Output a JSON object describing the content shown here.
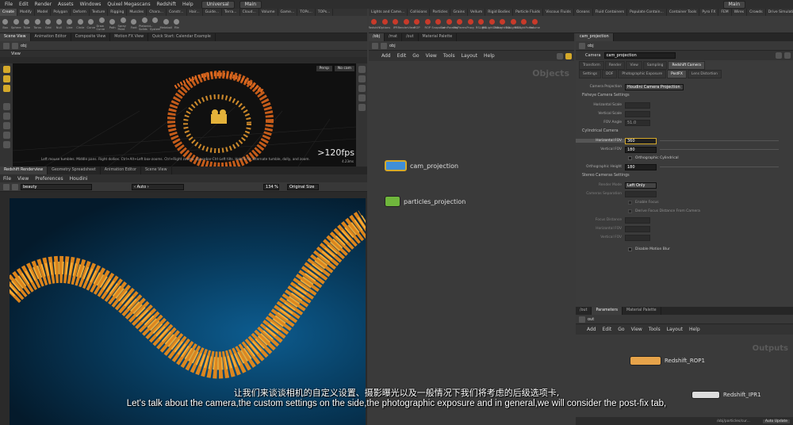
{
  "menu": {
    "items": [
      "File",
      "Edit",
      "Render",
      "Assets",
      "Windows",
      "Quixel Megascans",
      "Redshift",
      "Help"
    ],
    "desktop": "Universal",
    "workspace": "Main",
    "right_workspace": "Main"
  },
  "shelf_left": {
    "tabs": [
      "Create",
      "Modify",
      "Model",
      "Polygon",
      "Deform",
      "Texture",
      "Rigging",
      "Muscles",
      "Chara...",
      "Constr...",
      "Hair...",
      "Guide...",
      "Terra...",
      "Cloud...",
      "Volume",
      "Game...",
      "TOPs...",
      "TOPs..."
    ],
    "tools": [
      "Box",
      "Sphere",
      "Tube",
      "Torus",
      "Grid",
      "Null",
      "Line",
      "Circle",
      "Curve",
      "Draw Curve",
      "Path",
      "Spray Paint",
      "Font",
      "Platonic Solids",
      "L-System",
      "Metaball",
      "File"
    ]
  },
  "shelf_right": {
    "tabs": [
      "Lights and Came...",
      "Collisions",
      "Particles",
      "Grains",
      "Vellum",
      "Rigid Bodies",
      "Particle Fluids",
      "Viscous Fluids",
      "Oceans",
      "Fluid Containers",
      "Populate Contain...",
      "Container Tools",
      "Pyro FX",
      "FEM",
      "Wires",
      "Crowds",
      "Drive Simulation",
      "Scripts",
      "Redshift"
    ],
    "tools": [
      "Redshift",
      "Options",
      "IPR",
      "RenderView",
      "ROP",
      "ROP",
      "Snapshot",
      "CamParams",
      "ObjParms",
      "Proxy",
      "RSLight",
      "RSLightDome",
      "RSLightSun",
      "RSLightIES",
      "RSLightPortal",
      "Volume"
    ]
  },
  "scene_tabs": [
    "Scene View",
    "Animation Editor",
    "Composite View",
    "Motion FX View",
    "Quick Start: Calendar Example"
  ],
  "scene_path": "obj",
  "view_label": "View",
  "viewport": {
    "persp": "Persp",
    "cam": "No cam",
    "fps": ">120fps",
    "fps_small": "4.23ms",
    "hint": "Left mouse tumbles. Middle pans. Right dollies. Ctrl+Alt+Left box-zooms. Ctrl+Right zooms. Spacebar-Ctrl-Left tilts. Hold S for alternate tumble, dolly, and zoom."
  },
  "render_tabs": [
    "Redshift Renderview",
    "Geometry Spreadsheet",
    "Animation Editor",
    "Scene View"
  ],
  "render_menu": [
    "File",
    "View",
    "Preferences",
    "Houdini"
  ],
  "render_toolbar": {
    "beauty": "beauty",
    "auto": "‹ Auto ›",
    "zoom": "134 %",
    "size": "Original Size"
  },
  "net_tabs": [
    "/obj",
    "/mat",
    "/out",
    "Material Palette"
  ],
  "net_path": "obj",
  "net_menu": [
    "Add",
    "Edit",
    "Go",
    "View",
    "Tools",
    "Layout",
    "Help"
  ],
  "net_title": "Objects",
  "nodes": [
    {
      "name": "cam_projection"
    },
    {
      "name": "particles_projection"
    }
  ],
  "param_tabs": [
    "cam_projection"
  ],
  "param_header": {
    "type": "Camera",
    "name": "cam_projection"
  },
  "param_top_tabs": [
    "Transform",
    "Render",
    "View",
    "Sampling",
    "Redshift Camera"
  ],
  "param_sub_tabs": [
    "Settings",
    "DOF",
    "Photographic Exposure",
    "PostFX",
    "Lens Distortion"
  ],
  "params": {
    "camera_projection_label": "Camera Projection",
    "camera_projection": "Houdini Camera Projection",
    "fisheye_section": "Fisheye Camera Settings",
    "fisheye": [
      {
        "label": "Horizontal Scale",
        "value": ""
      },
      {
        "label": "Vertical Scale",
        "value": ""
      },
      {
        "label": "FOV Angle",
        "value": "51.0"
      }
    ],
    "cyl_section": "Cylindrical Camera",
    "horiz_fov_label": "Horizontal FOV",
    "horiz_fov": "360",
    "vert_fov_label": "Vertical FOV",
    "vert_fov": "180",
    "ortho_cyl": "Orthographic Cylindrical",
    "ortho_height_label": "Orthographic Height",
    "ortho_height": "180",
    "stereo_section": "Stereo Cameras Settings",
    "render_mode_label": "Render Mode",
    "render_mode": "Left Only",
    "cam_sep_label": "Cameras Separation",
    "cam_sep": "",
    "enable_focus": "Enable Focus",
    "derive_focus": "Derive Focus Distance From Camera",
    "focus_dist_label": "Focus Distance",
    "horiz_fov2_label": "Horizontal FOV",
    "vert_fov2_label": "Vertical FOV",
    "disable_mb": "Disable Motion Blur"
  },
  "out_tabs": [
    "/out",
    "Parameters",
    "Material Palette"
  ],
  "out_path": "out",
  "out_menu": [
    "Add",
    "Edit",
    "Go",
    "View",
    "Tools",
    "Layout",
    "Help"
  ],
  "out_title": "Outputs",
  "rops": [
    {
      "name": "Redshift_ROP1"
    },
    {
      "name": "Redshift_IPR1"
    }
  ],
  "status": {
    "path": "/obj/particles/cur...",
    "auto_update": "Auto Update"
  },
  "subtitles": {
    "zh": "让我们来谈谈相机的自定义设置、摄影曝光以及一般情况下我们将考虑的后级选项卡,",
    "en": "Let's talk about the camera,the custom settings on the side,the photographic exposure and in general,we will consider the post-fix tab,"
  },
  "colors": {
    "accent": "#d5a92a",
    "cam_node": "#3f8fd8",
    "particle_node": "#6fb63c",
    "rop_node": "#e6a34a"
  }
}
